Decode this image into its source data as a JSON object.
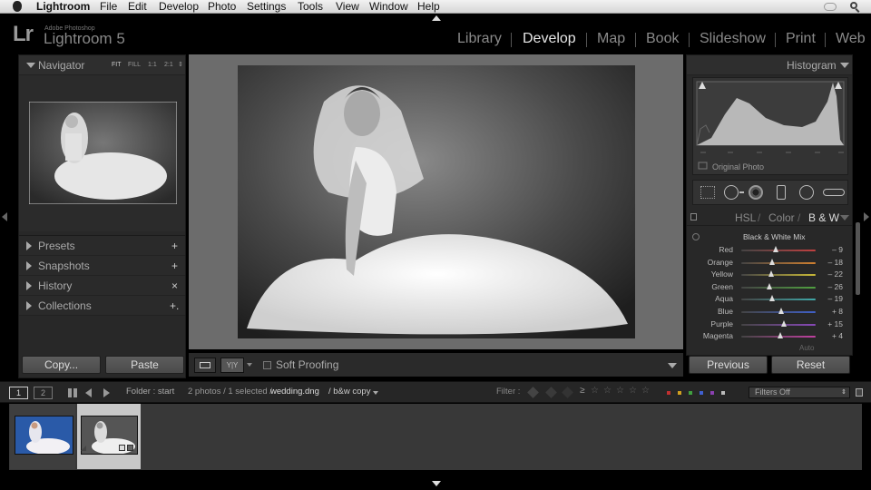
{
  "menubar": {
    "app_name": "Lightroom",
    "items": [
      "File",
      "Edit",
      "Develop",
      "Photo",
      "Settings",
      "Tools",
      "View",
      "Window",
      "Help"
    ]
  },
  "identity": {
    "logo": "Lr",
    "subtitle": "Adobe Photoshop",
    "name": "Lightroom 5"
  },
  "modules": [
    {
      "label": "Library",
      "active": false
    },
    {
      "label": "Develop",
      "active": true
    },
    {
      "label": "Map",
      "active": false
    },
    {
      "label": "Book",
      "active": false
    },
    {
      "label": "Slideshow",
      "active": false
    },
    {
      "label": "Print",
      "active": false
    },
    {
      "label": "Web",
      "active": false
    }
  ],
  "left_panel": {
    "navigator": {
      "title": "Navigator",
      "zoom_options": [
        "FIT",
        "FILL",
        "1:1",
        "2:1"
      ]
    },
    "sections": [
      {
        "label": "Presets",
        "action": "+"
      },
      {
        "label": "Snapshots",
        "action": "+"
      },
      {
        "label": "History",
        "action": "×"
      },
      {
        "label": "Collections",
        "action": "+."
      }
    ],
    "copy_label": "Copy...",
    "paste_label": "Paste"
  },
  "toolbar": {
    "soft_proofing_label": "Soft Proofing",
    "soft_proofing_checked": false,
    "view_yy_label": "Y|Y"
  },
  "right_panel": {
    "histogram": {
      "title": "Histogram",
      "original_photo_label": "Original Photo"
    },
    "hsl_tabs": [
      "HSL",
      "Color",
      "B & W"
    ],
    "hsl_active": "B & W",
    "bw_title": "Black & White Mix",
    "bw_sliders": [
      {
        "label": "Red",
        "value": "– 9",
        "fraction": 0.46,
        "color": "#c04040"
      },
      {
        "label": "Orange",
        "value": "– 18",
        "fraction": 0.42,
        "color": "#d08030"
      },
      {
        "label": "Yellow",
        "value": "– 22",
        "fraction": 0.4,
        "color": "#c8b838"
      },
      {
        "label": "Green",
        "value": "– 26",
        "fraction": 0.38,
        "color": "#50a040"
      },
      {
        "label": "Aqua",
        "value": "– 19",
        "fraction": 0.41,
        "color": "#40a8a8"
      },
      {
        "label": "Blue",
        "value": "+ 8",
        "fraction": 0.54,
        "color": "#4060c8"
      },
      {
        "label": "Purple",
        "value": "+ 15",
        "fraction": 0.57,
        "color": "#8848b8"
      },
      {
        "label": "Magenta",
        "value": "+ 4",
        "fraction": 0.52,
        "color": "#c040a0"
      }
    ],
    "auto_label": "Auto",
    "previous_label": "Previous",
    "reset_label": "Reset"
  },
  "filmstrip_bar": {
    "screen1": "1",
    "screen2": "2",
    "source": "Folder : start",
    "count": "2 photos / 1 selected /",
    "filename": "wedding.dng",
    "copy_name": "/ b&w copy",
    "filter_label": "Filter :",
    "filters_off": "Filters Off",
    "label_colors": [
      "#c03030",
      "#d0a020",
      "#40a040",
      "#4060d0",
      "#8a40b0"
    ]
  },
  "filmstrip": {
    "thumbnails": [
      {
        "name": "wedding-color-thumb",
        "selected": false
      },
      {
        "name": "wedding-bw-thumb",
        "selected": true
      }
    ]
  }
}
